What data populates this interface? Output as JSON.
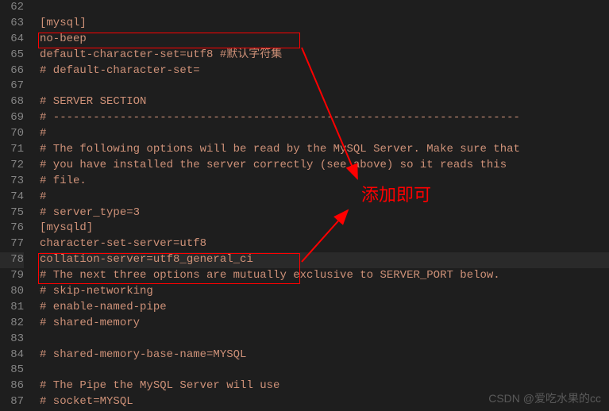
{
  "lines": [
    {
      "num": "62",
      "text": ""
    },
    {
      "num": "63",
      "text": "[mysql]"
    },
    {
      "num": "64",
      "text": "no-beep"
    },
    {
      "num": "65",
      "text": "default-character-set=utf8 #默认字符集"
    },
    {
      "num": "66",
      "text": "# default-character-set="
    },
    {
      "num": "67",
      "text": ""
    },
    {
      "num": "68",
      "text": "# SERVER SECTION"
    },
    {
      "num": "69",
      "text": "# ----------------------------------------------------------------------"
    },
    {
      "num": "70",
      "text": "#"
    },
    {
      "num": "71",
      "text": "# The following options will be read by the MySQL Server. Make sure that"
    },
    {
      "num": "72",
      "text": "# you have installed the server correctly (see above) so it reads this"
    },
    {
      "num": "73",
      "text": "# file."
    },
    {
      "num": "74",
      "text": "#"
    },
    {
      "num": "75",
      "text": "# server_type=3"
    },
    {
      "num": "76",
      "text": "[mysqld]"
    },
    {
      "num": "77",
      "text": "character-set-server=utf8"
    },
    {
      "num": "78",
      "text": "collation-server=utf8_general_ci",
      "current": true
    },
    {
      "num": "79",
      "text": "# The next three options are mutually exclusive to SERVER_PORT below."
    },
    {
      "num": "80",
      "text": "# skip-networking"
    },
    {
      "num": "81",
      "text": "# enable-named-pipe"
    },
    {
      "num": "82",
      "text": "# shared-memory"
    },
    {
      "num": "83",
      "text": ""
    },
    {
      "num": "84",
      "text": "# shared-memory-base-name=MYSQL"
    },
    {
      "num": "85",
      "text": ""
    },
    {
      "num": "86",
      "text": "# The Pipe the MySQL Server will use"
    },
    {
      "num": "87",
      "text": "# socket=MYSQL"
    }
  ],
  "annotation": "添加即可",
  "watermark": "CSDN @爱吃水果的cc"
}
